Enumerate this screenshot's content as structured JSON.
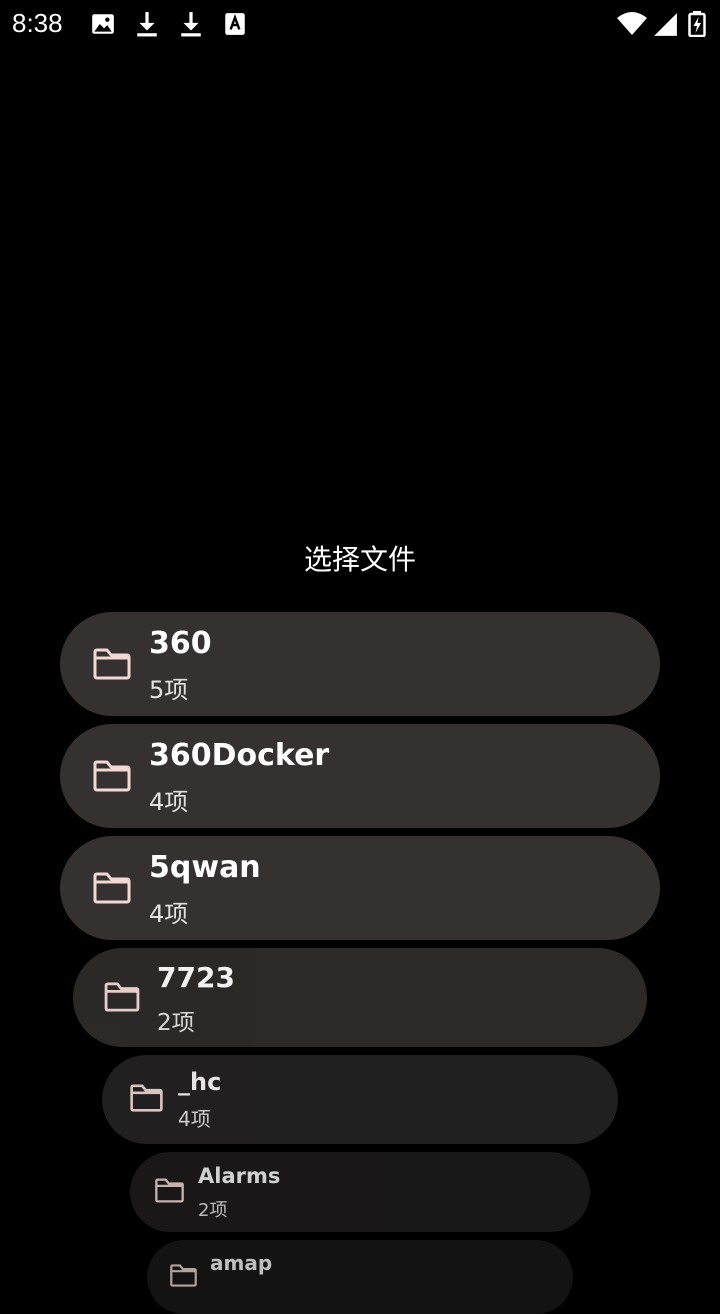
{
  "status_bar": {
    "time": "8:38",
    "left_icons": [
      "image-icon",
      "download-icon",
      "download-icon",
      "font-a-icon"
    ],
    "right_icons": [
      "wifi-icon",
      "signal-icon",
      "battery-charging-icon"
    ]
  },
  "dialog": {
    "title": "选择文件",
    "items": [
      {
        "name": "360",
        "count": "5项",
        "icon": "folder-icon"
      },
      {
        "name": "360Docker",
        "count": "4项",
        "icon": "folder-icon"
      },
      {
        "name": "5qwan",
        "count": "4项",
        "icon": "folder-icon"
      },
      {
        "name": "7723",
        "count": "2项",
        "icon": "folder-icon"
      },
      {
        "name": "_hc",
        "count": "4项",
        "icon": "folder-icon"
      },
      {
        "name": "Alarms",
        "count": "2项",
        "icon": "folder-icon"
      },
      {
        "name": "amap",
        "count": "",
        "icon": "folder-icon"
      }
    ]
  },
  "colors": {
    "background": "#000000",
    "card": "#353131",
    "folder_icon": "#f3d9d3",
    "text": "#ffffff"
  }
}
